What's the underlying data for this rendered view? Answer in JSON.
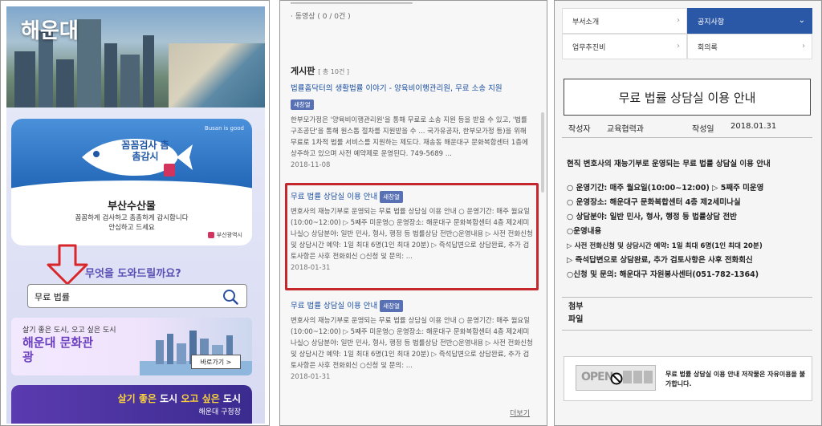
{
  "panel1": {
    "title": "해운대",
    "banner": {
      "fish_text": "꼼꼼검사 촘촘감시",
      "tagline": "Busan is good",
      "title": "부산수산물",
      "desc_line1": "꼼꼼하게 검사하고 촘촘하게 감시합니다",
      "desc_line2": "안심하고 드세요",
      "logo": "부산광역시"
    },
    "question": "무엇을 도와드릴까요?",
    "search": {
      "value": "무료 법률"
    },
    "culture": {
      "tag": "살기 좋은 도시, 오고 싶은 도시",
      "name": "해운대 문화관광",
      "button": "바로가기 >"
    },
    "office": {
      "slogan_a": "살기 좋은",
      "slogan_b": " 도시 ",
      "slogan_c": "오고 싶은",
      "slogan_d": " 도시",
      "office": "해운대 구청장"
    }
  },
  "panel2": {
    "top_line1": "· 동영상 ( 0 / 0건 )",
    "board_label": "게시판",
    "board_count": "[ 총 10건 ]",
    "posts": [
      {
        "title": "법률홈닥터의 생활법률 이야기 - 양육비이행관리원, 무료 소송 지원",
        "new_window": "새창열",
        "body": "한부모가정은 '양육비이행관리원'을 통해 무료로 소송 지원 등을 받을 수 있고, '법률구조공단'을 통해 원스톱 절차를 지원받을 수 ... 국가유공자, 한부모가정 등)을 위해 무료로 1차적 법률 서비스를 지원하는 제도다. 재송동 해운대구 문화복합센터 1층에 상주하고 있으며 사전 예약제로 운영된다. 749-5689 ...",
        "date": "2018-11-08"
      },
      {
        "title": "무료 법률 상담실 이용 안내",
        "new_window": "새창열",
        "body": "변호사의 재능기부로 운영되는 무료 법률 상담실 이용 안내 ○ 운영기간: 매주 월요일(10:00~12:00) ▷ 5째주 미운영○ 운영장소: 해운대구 문화복합센터 4층 제2세미나실○ 상담분야: 일반 민사, 형사, 행정 등 법률상담 전반○운영내용 ▷ 사전 전화신청 및 상담시간 예약: 1일 최대 6명(1인 최대 20분) ▷ 즉석답변으로 상담완료, 추가 검토사항은 사후 전화회신 ○신청 및 문의: ...",
        "date": "2018-01-31"
      },
      {
        "title": "무료 법률 상담실 이용 안내",
        "new_window": "새창열",
        "body": "변호사의 재능기부로 운영되는 무료 법률 상담실 이용 안내 ○ 운영기간: 매주 월요일(10:00~12:00) ▷ 5째주 미운영○ 운영장소: 해운대구 문화복합센터 4층 제2세미나실○ 상담분야: 일반 민사, 형사, 행정 등 법률상담 전반○운영내용 ▷ 사전 전화신청 및 상담시간 예약: 1일 최대 6명(1인 최대 20분) ▷ 즉석답변으로 상담완료, 추가 검토사항은 사후 전화회신 ○신청 및 문의: ...",
        "date": "2018-01-31"
      }
    ],
    "more": "더보기"
  },
  "panel3": {
    "nav": [
      {
        "label": "부서소개",
        "active": false
      },
      {
        "label": "공지사항",
        "active": true
      },
      {
        "label": "업무추진비",
        "active": false
      },
      {
        "label": "회의록",
        "active": false
      }
    ],
    "title": "무료 법률 상담실 이용 안내",
    "meta": {
      "author_label": "작성자",
      "author": "교육협력과",
      "date_label": "작성일",
      "date": "2018.01.31"
    },
    "content": [
      "현직 변호사의 재능기부로 운영되는 무료 법률 상담실 이용 안내",
      "",
      "○ 운영기간: 매주 월요일(10:00~12:00) ▷ 5째주 미운영",
      "○ 운영장소: 해운대구 문화복합센터 4층 제2세미나실",
      "○ 상담분야: 일반 민사, 형사, 행정 등 법률상담 전반",
      "○운영내용",
      "▷ 사전 전화신청 및 상담시간 예약: 1일 최대 6명(1인 최대 20분)",
      "▷ 즉석답변으로 상담완료, 추가 검토사항은 사후 전화회신",
      "○신청 및 문의: 해운대구 자원봉사센터(051-782-1364)"
    ],
    "attach_label": "첨부파일",
    "license_text": "무료 법률 상담실 이용 안내 저작물은 자유이용을 불가합니다.",
    "kogl_open": "OPEN"
  }
}
